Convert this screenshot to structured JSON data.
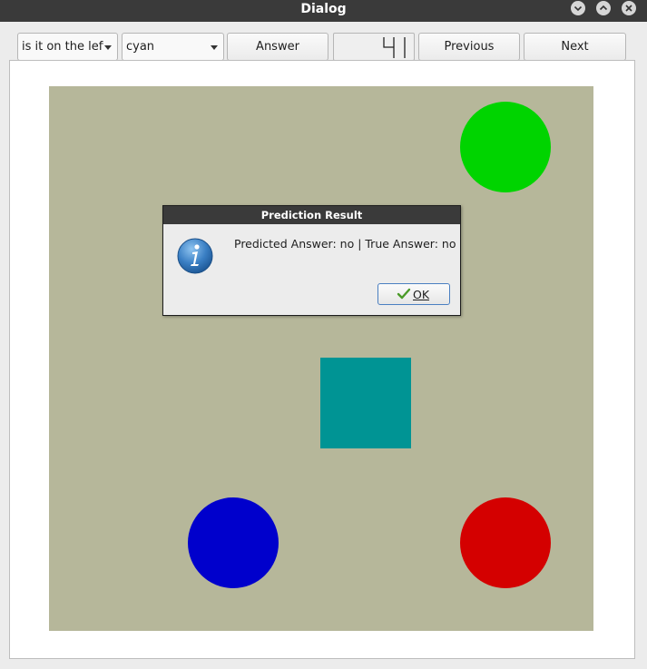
{
  "window": {
    "title": "Dialog"
  },
  "toolbar": {
    "question_select": "is it on the left",
    "color_select": "cyan",
    "answer_button": "Answer",
    "counter_value": "41",
    "previous_button": "Previous",
    "next_button": "Next"
  },
  "scene": {
    "background_color": "#b6b79a",
    "shapes": [
      {
        "kind": "circle",
        "color": "#00d400"
      },
      {
        "kind": "square",
        "color": "#009494"
      },
      {
        "kind": "circle",
        "color": "#0000cc"
      },
      {
        "kind": "circle",
        "color": "#d40000"
      }
    ]
  },
  "message_box": {
    "title": "Prediction Result",
    "icon": "information-icon",
    "text": "Predicted Answer: no | True Answer: no",
    "ok_label": "OK"
  }
}
